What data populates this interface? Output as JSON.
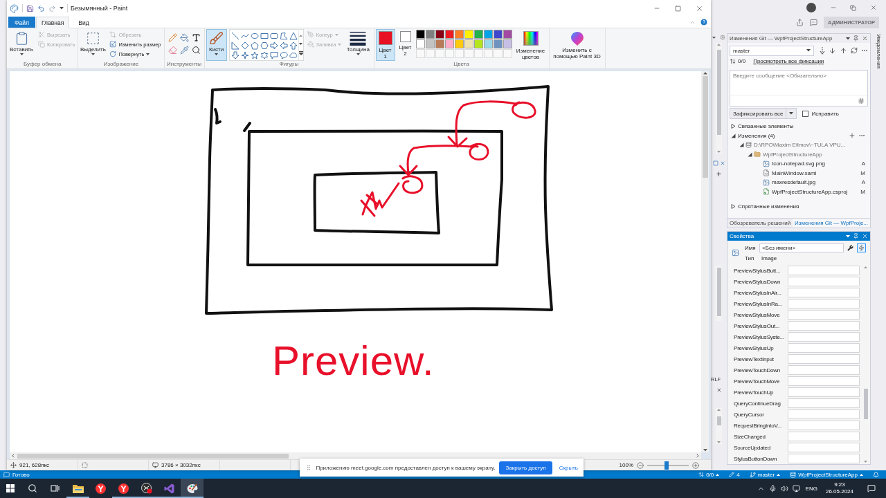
{
  "paint": {
    "title": "Безымянный - Paint",
    "tabs": [
      {
        "label": "Файл",
        "kind": "file",
        "selected": false
      },
      {
        "label": "Главная",
        "kind": "tab",
        "selected": true
      },
      {
        "label": "Вид",
        "kind": "tab",
        "selected": false
      }
    ],
    "ribbon": {
      "clipboard": {
        "label": "Буфер обмена",
        "paste": "Вставить",
        "actions": [
          {
            "label": "Вырезать",
            "kind": "cut",
            "disabled": true
          },
          {
            "label": "Копировать",
            "kind": "copy",
            "disabled": true
          }
        ]
      },
      "image": {
        "label": "Изображение",
        "select": "Выделить",
        "actions": [
          {
            "label": "Обрезать",
            "kind": "crop",
            "disabled": true
          },
          {
            "label": "Изменить размер",
            "kind": "resize",
            "disabled": false
          },
          {
            "label": "Повернуть",
            "kind": "rotate",
            "disabled": false
          }
        ]
      },
      "tools": {
        "label": "Инструменты"
      },
      "shapes": {
        "label": "Фигуры",
        "brushes": {
          "label": "Кисти",
          "selected": true
        },
        "options": [
          {
            "label": "Контур",
            "kind": "outline",
            "disabled": true
          },
          {
            "label": "Заливка",
            "kind": "fill",
            "disabled": true
          }
        ],
        "size": "Толщина"
      },
      "colors": {
        "label": "Цвета",
        "slots": [
          {
            "label": "Цвет 1",
            "color": "#e81123",
            "selected": true
          },
          {
            "label": "Цвет 2",
            "color": "#ffffff",
            "selected": false
          }
        ],
        "palette": [
          {
            "color": "#000000"
          },
          {
            "color": "#7f7f7f"
          },
          {
            "color": "#880015"
          },
          {
            "color": "#ed1c24"
          },
          {
            "color": "#ff7f27"
          },
          {
            "color": "#fff200"
          },
          {
            "color": "#22b14c"
          },
          {
            "color": "#00a2e8"
          },
          {
            "color": "#3f48cc"
          },
          {
            "color": "#a349a4"
          },
          {
            "color": "#ffffff"
          },
          {
            "color": "#c3c3c3"
          },
          {
            "color": "#b97a57"
          },
          {
            "color": "#ffaec9"
          },
          {
            "color": "#ffc90e"
          },
          {
            "color": "#efe4b0"
          },
          {
            "color": "#b5e61d"
          },
          {
            "color": "#99d9ea"
          },
          {
            "color": "#7092be"
          },
          {
            "color": "#c8bfe7"
          }
        ],
        "edit": "Изменение цветов"
      },
      "paint3d": "Изменить с помощью Paint 3D"
    },
    "canvas": {
      "handwriting": "Preview."
    },
    "status": {
      "cursor": "921, 628пкс",
      "image_size": "3786 × 3032пкс",
      "zoom": {
        "label": "100%",
        "level": 0.47
      }
    }
  },
  "share_bar": {
    "message": "Приложению meet.google.com предоставлен доступ к вашему экрану.",
    "stop": "Закрыть доступ",
    "hide": "Скрыть"
  },
  "vs": {
    "title_bar": {
      "badge": "АДМИНИСТРАТОР"
    },
    "side_tab": "Уведомления",
    "editor_strip": {
      "line_ending": "RLF"
    },
    "git": {
      "title": "Изменения Git — WpfProjectStructureApp",
      "branch": "master",
      "commits": "0/0",
      "view_all": "Просмотреть все фиксации",
      "message_placeholder": "Введите сообщение <Обязательно>",
      "commit_button": "Зафиксировать все",
      "amend": {
        "label": "Исправить",
        "checked": false
      },
      "tree": [
        {
          "label": "Связанные элементы",
          "kind": "section",
          "expanded": false
        },
        {
          "label": "Изменения (4)",
          "kind": "changes",
          "expanded": true,
          "children": [
            {
              "label": "D:\\RPO\\Maxim Efimov\\~TULA VPU...",
              "kind": "repo",
              "expanded": true,
              "children": [
                {
                  "label": "WpfProjectStructureApp",
                  "kind": "folder",
                  "expanded": true,
                  "children": [
                    {
                      "label": "Icon-notepad.svg.png",
                      "kind": "image",
                      "status": "A"
                    },
                    {
                      "label": "MainWindow.xaml",
                      "kind": "xaml",
                      "status": "M"
                    },
                    {
                      "label": "maxresdefault.jpg",
                      "kind": "image",
                      "status": "A"
                    },
                    {
                      "label": "WpfProjectStructureApp.csproj",
                      "kind": "project",
                      "status": "M"
                    }
                  ]
                }
              ]
            }
          ]
        },
        {
          "label": "Спрятанные изменения",
          "kind": "section",
          "expanded": false
        }
      ],
      "tabs": [
        {
          "label": "Обозреватель решений",
          "selected": false
        },
        {
          "label": "Изменения Git — WpfProje...",
          "selected": true
        }
      ]
    },
    "properties": {
      "title": "Свойства",
      "name": {
        "label": "Имя",
        "value": "<Без имени>"
      },
      "type": {
        "label": "Тип",
        "value": "Image"
      },
      "views": [
        {
          "kind": "properties",
          "selected": false
        },
        {
          "kind": "events",
          "selected": true
        }
      ],
      "events": [
        "PreviewStylusButt...",
        "PreviewStylusDown",
        "PreviewStylusInAir...",
        "PreviewStylusInRa...",
        "PreviewStylusMove",
        "PreviewStylusOut...",
        "PreviewStylusSyste...",
        "PreviewStylusUp",
        "PreviewTextInput",
        "PreviewTouchDown",
        "PreviewTouchMove",
        "PreviewTouchUp",
        "QueryContinueDrag",
        "QueryCursor",
        "RequestBringIntoV...",
        "SizeChanged",
        "SourceUpdated",
        "StylusButtonDown"
      ]
    },
    "status_bar": {
      "ready": "Готово",
      "commits": "0/0",
      "changes": "4",
      "branch": "master",
      "repo": "WpfProjectStructureApp"
    }
  },
  "taskbar": {
    "apps": [
      {
        "kind": "explorer",
        "running": true,
        "selected": false
      },
      {
        "kind": "browser",
        "running": false,
        "selected": false
      },
      {
        "kind": "browser",
        "running": true,
        "selected": false
      },
      {
        "kind": "recorder",
        "running": true,
        "selected": false
      },
      {
        "kind": "ide",
        "running": true,
        "selected": false
      },
      {
        "kind": "paint",
        "running": true,
        "selected": true
      }
    ],
    "language": "ENG",
    "time": "9:23",
    "date": "26.05.2024"
  }
}
